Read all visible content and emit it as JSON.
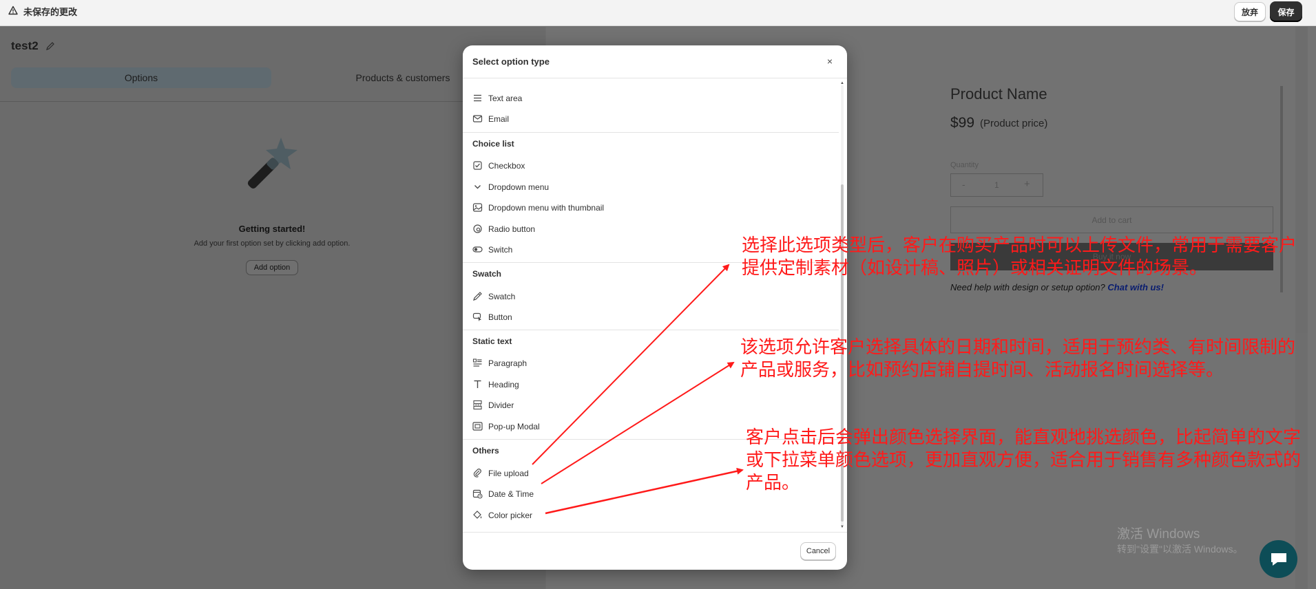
{
  "topbar": {
    "unsaved_label": "未保存的更改",
    "discard_label": "放弃",
    "save_label": "保存"
  },
  "editor": {
    "title": "test2",
    "tabs": [
      {
        "label": "Options"
      },
      {
        "label": "Products & customers"
      }
    ],
    "empty_state": {
      "title": "Getting started!",
      "subtitle": "Add your first option set by clicking add option.",
      "button_label": "Add option"
    }
  },
  "preview": {
    "product_name": "Product Name",
    "price": "$99",
    "price_note": "(Product price)",
    "quantity_label": "Quantity",
    "quantity_minus": "-",
    "quantity_value": "1",
    "quantity_plus": "+",
    "add_to_cart_label": "Add to cart",
    "buy_now_label": "Buy it now",
    "help_text": "Need help with design or setup option?",
    "help_link": "Chat with us!"
  },
  "modal": {
    "title": "Select option type",
    "close_icon": "×",
    "cancel_label": "Cancel",
    "items_top": [
      {
        "label": "Text area",
        "icon": "text-area-icon"
      },
      {
        "label": "Email",
        "icon": "email-icon"
      }
    ],
    "groups": [
      {
        "title": "Choice list",
        "items": [
          {
            "label": "Checkbox",
            "icon": "checkbox-icon"
          },
          {
            "label": "Dropdown menu",
            "icon": "chevron-down-icon"
          },
          {
            "label": "Dropdown menu with thumbnail",
            "icon": "image-icon"
          },
          {
            "label": "Radio button",
            "icon": "radio-icon"
          },
          {
            "label": "Switch",
            "icon": "toggle-icon"
          }
        ]
      },
      {
        "title": "Swatch",
        "items": [
          {
            "label": "Swatch",
            "icon": "eyedropper-icon"
          },
          {
            "label": "Button",
            "icon": "cursor-icon"
          }
        ]
      },
      {
        "title": "Static text",
        "items": [
          {
            "label": "Paragraph",
            "icon": "paragraph-icon"
          },
          {
            "label": "Heading",
            "icon": "heading-icon"
          },
          {
            "label": "Divider",
            "icon": "divider-icon"
          },
          {
            "label": "Pop-up Modal",
            "icon": "popup-icon"
          }
        ]
      },
      {
        "title": "Others",
        "items": [
          {
            "label": "File upload",
            "icon": "paperclip-icon"
          },
          {
            "label": "Date & Time",
            "icon": "calendar-icon"
          },
          {
            "label": "Color picker",
            "icon": "paint-bucket-icon"
          }
        ]
      }
    ]
  },
  "annotations": [
    {
      "text": "选择此选项类型后，客户在购买产品时可以上传文件，常用于需要客户提供定制素材（如设计稿、照片）或相关证明文件的场景。"
    },
    {
      "text": "该选项允许客户选择具体的日期和时间，适用于预约类、有时间限制的产品或服务，比如预约店铺自提时间、活动报名时间选择等。"
    },
    {
      "text": "客户点击后会弹出颜色选择界面，能直观地挑选颜色，比起简单的文字或下拉菜单颜色选项，更加直观方便，适合用于销售有多种颜色款式的产品。"
    }
  ],
  "watermark": {
    "line1": "激活 Windows",
    "line2": "转到\"设置\"以激活 Windows。"
  },
  "colors": {
    "annotation": "#ff1a1a",
    "primary_button": "#303030",
    "overlay": "#6e6e6e",
    "chat_bubble": "#0d4d57"
  }
}
